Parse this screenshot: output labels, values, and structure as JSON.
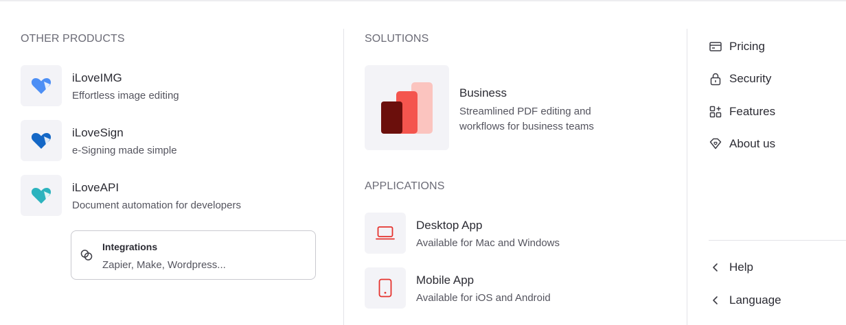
{
  "other_products": {
    "heading": "OTHER PRODUCTS",
    "items": [
      {
        "title": "iLoveIMG",
        "desc": "Effortless image editing",
        "color": "#4d8ff5"
      },
      {
        "title": "iLoveSign",
        "desc": "e-Signing made simple",
        "color": "#1467c6"
      },
      {
        "title": "iLoveAPI",
        "desc": "Document automation for developers",
        "color": "#2cb3be"
      }
    ],
    "integrations": {
      "title": "Integrations",
      "desc": "Zapier, Make, Wordpress..."
    }
  },
  "solutions": {
    "heading": "SOLUTIONS",
    "business": {
      "title": "Business",
      "desc": "Streamlined PDF editing and workflows for business teams"
    }
  },
  "applications": {
    "heading": "APPLICATIONS",
    "items": [
      {
        "title": "Desktop App",
        "desc": "Available for Mac and Windows"
      },
      {
        "title": "Mobile App",
        "desc": "Available for iOS and Android"
      }
    ]
  },
  "nav": {
    "top": [
      {
        "label": "Pricing",
        "icon": "credit-card-icon"
      },
      {
        "label": "Security",
        "icon": "lock-icon"
      },
      {
        "label": "Features",
        "icon": "grid-plus-icon"
      },
      {
        "label": "About us",
        "icon": "tag-heart-icon"
      }
    ],
    "bottom": [
      {
        "label": "Help",
        "icon": "chevron-left-icon"
      },
      {
        "label": "Language",
        "icon": "chevron-left-icon"
      }
    ]
  },
  "colors": {
    "accent": "#e5322d"
  }
}
